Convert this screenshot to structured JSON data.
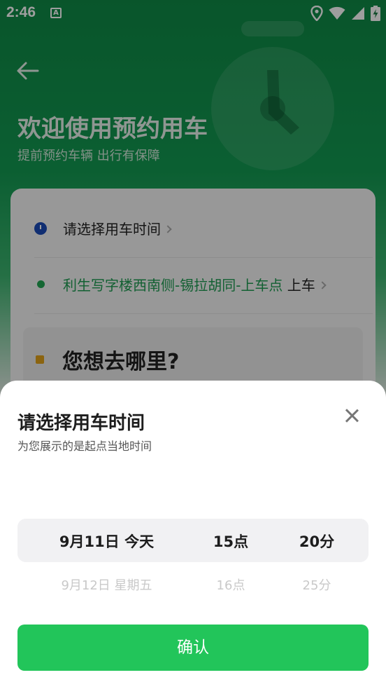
{
  "status_bar": {
    "time": "2:46",
    "a_label": "A"
  },
  "hero": {
    "title": "欢迎使用预约用车",
    "subtitle": "提前预约车辆 出行有保障"
  },
  "card": {
    "time_row": "请选择用车时间",
    "pickup_name": "利生写字楼西南侧-锡拉胡同-上车点",
    "pickup_suffix": "上车",
    "destination": "您想去哪里?"
  },
  "sheet": {
    "title": "请选择用车时间",
    "subtitle": "为您展示的是起点当地时间",
    "picker": {
      "date_selected": "9月11日 今天",
      "date_next": "9月12日 星期五",
      "hour_selected": "15点",
      "hour_next": "16点",
      "minute_selected": "20分",
      "minute_next": "25分"
    },
    "confirm_label": "确认"
  },
  "icons": {
    "back": "arrow-left-icon",
    "close": "close-icon",
    "location": "location-pin-icon",
    "wifi": "wifi-icon",
    "signal": "signal-icon",
    "battery": "battery-charging-icon"
  },
  "colors": {
    "brand_green": "#22c55a",
    "hero_green": "#0f8a46",
    "pickup_text": "#1e9c52"
  }
}
